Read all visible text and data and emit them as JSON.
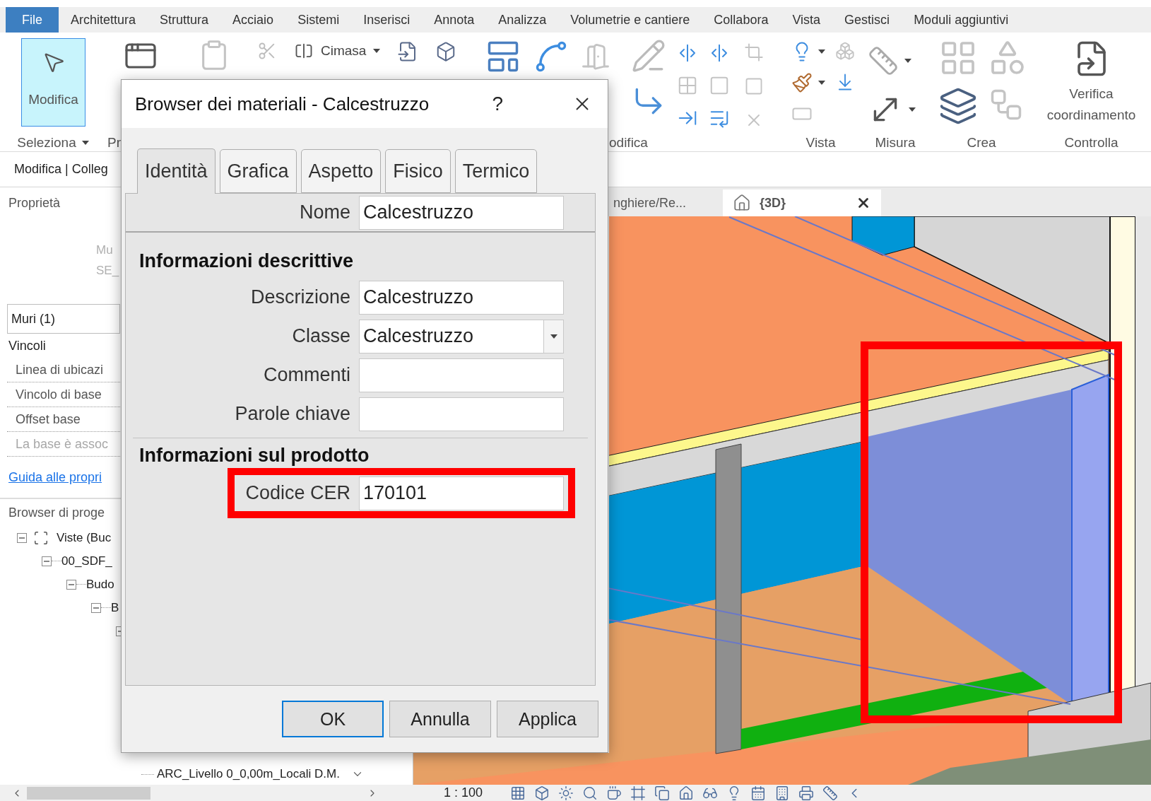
{
  "menu_tabs": [
    {
      "label": "File",
      "kind": "file"
    },
    {
      "label": "Architettura",
      "kind": "tab"
    },
    {
      "label": "Struttura",
      "kind": "tab"
    },
    {
      "label": "Acciaio",
      "kind": "tab"
    },
    {
      "label": "Sistemi",
      "kind": "tab"
    },
    {
      "label": "Inserisci",
      "kind": "tab"
    },
    {
      "label": "Annota",
      "kind": "tab"
    },
    {
      "label": "Analizza",
      "kind": "tab"
    },
    {
      "label": "Volumetrie e cantiere",
      "kind": "tab"
    },
    {
      "label": "Collabora",
      "kind": "tab"
    },
    {
      "label": "Vista",
      "kind": "tab"
    },
    {
      "label": "Gestisci",
      "kind": "tab"
    },
    {
      "label": "Moduli aggiuntivi",
      "kind": "tab"
    }
  ],
  "ribbon": {
    "panels": [
      {
        "kind": "select",
        "label": "Seleziona",
        "dropdown": true,
        "button": {
          "label": "Modifica",
          "selected": true
        }
      },
      {
        "kind": "properties",
        "label": "Pr"
      },
      {
        "kind": "clipboard"
      },
      {
        "kind": "geometry",
        "button": "Cimasa"
      },
      {
        "kind": "modify",
        "label": "odifica"
      },
      {
        "kind": "view",
        "label": "Vista"
      },
      {
        "kind": "measure",
        "label": "Misura"
      },
      {
        "kind": "create",
        "label": "Crea"
      },
      {
        "kind": "check",
        "label": "Controlla",
        "button": "Verifica coordinamento"
      }
    ]
  },
  "context_bar": {
    "label": "Modifica | Colleg"
  },
  "properties": {
    "title": "Proprietà",
    "type_preview": [
      "Mu",
      "SE_"
    ],
    "type_selector": "Muri (1)",
    "group": "Vincoli",
    "rows": [
      {
        "label": "Linea di ubicazi",
        "disabled": false
      },
      {
        "label": "Vincolo di base",
        "disabled": false
      },
      {
        "label": "Offset base",
        "disabled": false
      },
      {
        "label": "La base è assoc",
        "disabled": true
      }
    ],
    "help_link": "Guida alle propri"
  },
  "project_browser": {
    "title": "Browser di proge",
    "tree": [
      {
        "label": "Viste (Buc",
        "expanded": true,
        "children": [
          {
            "label": "00_SDF_",
            "expanded": true,
            "children": [
              {
                "label": "Budo",
                "expanded": true,
                "children": [
                  {
                    "label": "B",
                    "expanded": true,
                    "children": [
                      {
                        "expanded": true
                      }
                    ]
                  }
                ]
              }
            ]
          }
        ]
      }
    ],
    "bottom_item": "ARC_Livello 0_0,00m_Locali D.M."
  },
  "view_tabs": [
    {
      "label": "nghiere/Re...",
      "selected": false
    },
    {
      "label": "{3D}",
      "selected": true
    }
  ],
  "view": {
    "highlight_frame": true
  },
  "status_bar": {
    "scale": "1 : 100"
  },
  "dialog": {
    "title": "Browser dei materiali - Calcestruzzo",
    "help": "?",
    "tabs": [
      {
        "label": "Identità",
        "selected": true
      },
      {
        "label": "Grafica",
        "selected": false
      },
      {
        "label": "Aspetto",
        "selected": false
      },
      {
        "label": "Fisico",
        "selected": false
      },
      {
        "label": "Termico",
        "selected": false
      }
    ],
    "name_field": {
      "label": "Nome",
      "value": "Calcestruzzo"
    },
    "sections": [
      {
        "title": "Informazioni descrittive",
        "fields": [
          {
            "label": "Descrizione",
            "value": "Calcestruzzo",
            "kind": "text"
          },
          {
            "label": "Classe",
            "value": "Calcestruzzo",
            "kind": "dropdown"
          },
          {
            "label": "Commenti",
            "kind": "text"
          },
          {
            "label": "Parole chiave",
            "kind": "text"
          }
        ]
      },
      {
        "title": "Informazioni sul prodotto",
        "fields": [
          {
            "label": "Codice CER",
            "value": "170101",
            "kind": "text",
            "highlighted": true
          }
        ]
      }
    ],
    "buttons": [
      {
        "label": "OK",
        "default": true
      },
      {
        "label": "Annulla",
        "default": false
      },
      {
        "label": "Applica",
        "default": false
      }
    ]
  }
}
